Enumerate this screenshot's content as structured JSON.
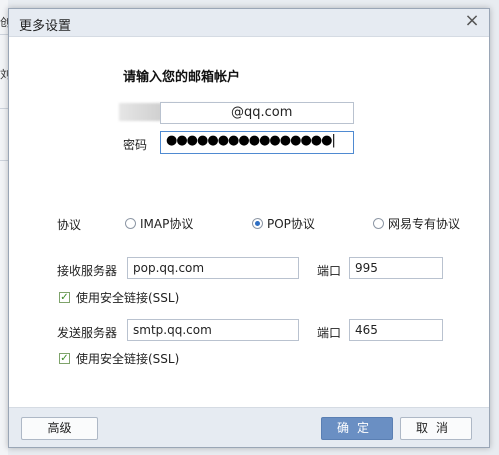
{
  "dialog": {
    "title": "更多设置",
    "close_symbol": "×"
  },
  "account": {
    "heading": "请输入您的邮箱帐户",
    "email_suffix": "@qq.com",
    "password_label": "密码",
    "password_mask": "●●●●●●●●●●●●●●●●|"
  },
  "protocol": {
    "label": "协议",
    "options": [
      "IMAP协议",
      "POP协议",
      "网易专有协议"
    ],
    "selected": "POP协议"
  },
  "incoming": {
    "label": "接收服务器",
    "server": "pop.qq.com",
    "port_label": "端口",
    "port": "995",
    "ssl_label": "使用安全链接(SSL)"
  },
  "outgoing": {
    "label": "发送服务器",
    "server": "smtp.qq.com",
    "port_label": "端口",
    "port": "465",
    "ssl_label": "使用安全链接(SSL)"
  },
  "footer": {
    "advanced": "高级",
    "ok": "确定",
    "cancel": "取消"
  },
  "background": {
    "glyph_top": "创",
    "glyph_mid": "刘"
  }
}
